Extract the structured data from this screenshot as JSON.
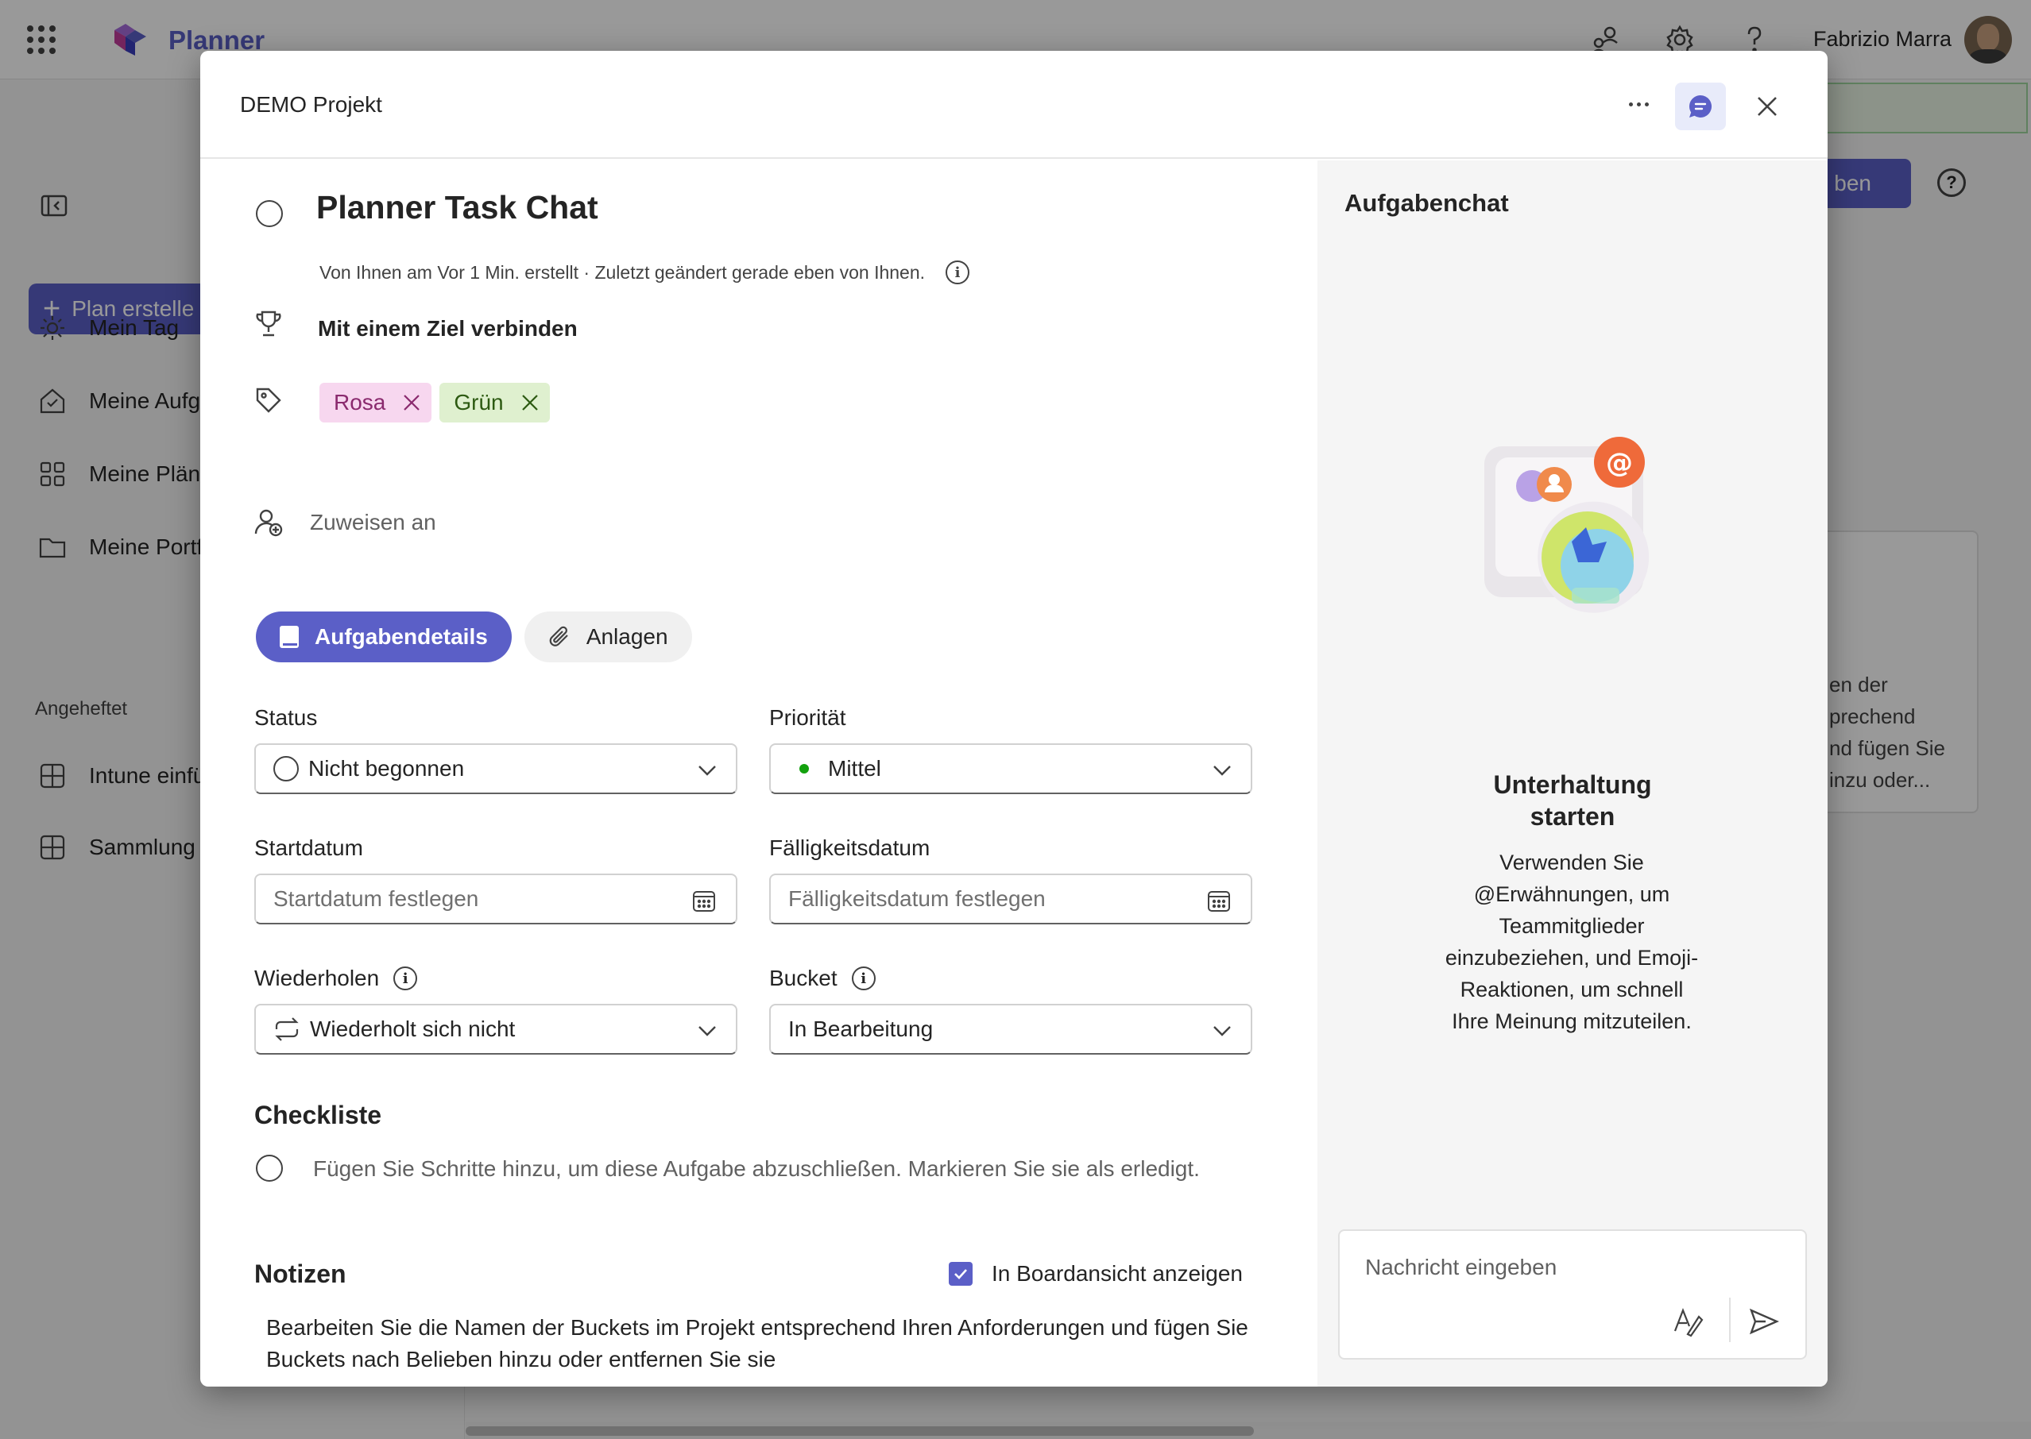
{
  "app": {
    "name": "Planner",
    "user_name": "Fabrizio Marra",
    "brand_color": "#5b5fc7"
  },
  "sidebar": {
    "create_button": "Plan erstelle",
    "items": [
      {
        "label": "Mein Tag",
        "icon": "sun-icon"
      },
      {
        "label": "Meine Aufg",
        "icon": "house-check-icon"
      },
      {
        "label": "Meine Plän",
        "icon": "grid-icon"
      },
      {
        "label": "Meine Portf",
        "icon": "folder-icon"
      }
    ],
    "pinned_heading": "Angeheftet",
    "pinned": [
      {
        "label": "Intune einfü",
        "icon": "board-icon"
      },
      {
        "label": "Sammlung",
        "icon": "board-icon"
      }
    ]
  },
  "background": {
    "button_label": "ben",
    "card_text": [
      "en der",
      "prechend",
      "nd fügen Sie",
      "inzu oder..."
    ]
  },
  "modal": {
    "plan_name": "DEMO Projekt",
    "task_title": "Planner Task Chat",
    "meta": "Von Ihnen am Vor 1 Min. erstellt · Zuletzt geändert gerade eben von Ihnen.",
    "goal_link": "Mit einem Ziel verbinden",
    "labels": [
      {
        "name": "Rosa",
        "bg": "#f7d7ef",
        "fg": "#8a2a6e"
      },
      {
        "name": "Grün",
        "bg": "#dff0cf",
        "fg": "#2d5a12"
      }
    ],
    "assign_placeholder": "Zuweisen an",
    "tabs": {
      "details": "Aufgabendetails",
      "attachments": "Anlagen"
    },
    "fields": {
      "status": {
        "label": "Status",
        "value": "Nicht begonnen"
      },
      "priority": {
        "label": "Priorität",
        "value": "Mittel",
        "dot_color": "#13a10e"
      },
      "start": {
        "label": "Startdatum",
        "placeholder": "Startdatum festlegen"
      },
      "due": {
        "label": "Fälligkeitsdatum",
        "placeholder": "Fälligkeitsdatum festlegen"
      },
      "repeat": {
        "label": "Wiederholen",
        "value": "Wiederholt sich nicht"
      },
      "bucket": {
        "label": "Bucket",
        "value": "In Bearbeitung"
      }
    },
    "checklist": {
      "title": "Checkliste",
      "hint": "Fügen Sie Schritte hinzu, um diese Aufgabe abzuschließen. Markieren Sie sie als erledigt."
    },
    "notes": {
      "title": "Notizen",
      "show_on_board_label": "In Boardansicht anzeigen",
      "show_on_board_checked": true,
      "text": "Bearbeiten Sie die Namen der Buckets im Projekt entsprechend Ihren Anforderungen und fügen Sie Buckets nach Belieben hinzu oder entfernen Sie sie"
    }
  },
  "chat": {
    "title": "Aufgabenchat",
    "empty_title": "Unterhaltung starten",
    "empty_body": "Verwenden Sie @Erwähnungen, um Teammitglieder einzubeziehen, und Emoji-Reaktionen, um schnell Ihre Meinung mitzuteilen.",
    "input_placeholder": "Nachricht eingeben"
  }
}
